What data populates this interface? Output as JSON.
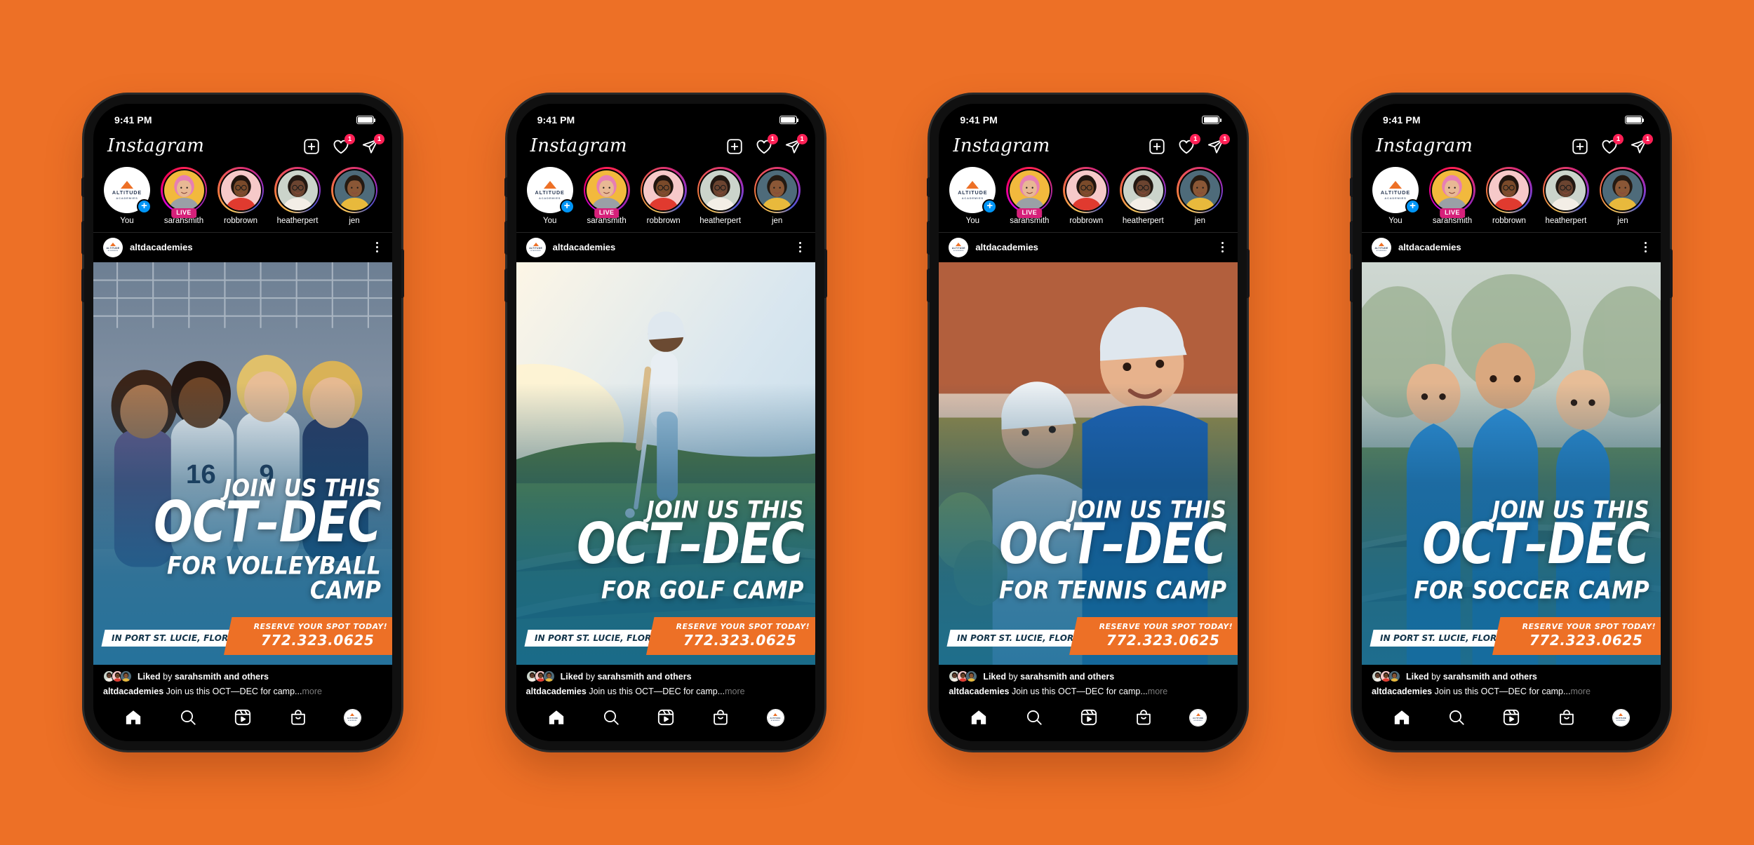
{
  "canvas": {
    "background_color": "#ED7026"
  },
  "status_bar": {
    "time": "9:41 PM",
    "battery_icon": "battery-full-icon"
  },
  "app_header": {
    "wordmark": "Instagram",
    "create_icon": "plus-square-icon",
    "activity_icon": "heart-icon",
    "activity_badge": "1",
    "messages_icon": "paper-plane-icon",
    "messages_badge": "1"
  },
  "stories": [
    {
      "name": "You",
      "ring": "none",
      "badge": "add-plus",
      "avatar": "altitude-academies-logo"
    },
    {
      "name": "sarahsmith",
      "ring": "live",
      "badge": "LIVE",
      "avatar": "woman-pink-hair"
    },
    {
      "name": "robbrown",
      "ring": "gradient",
      "badge": "",
      "avatar": "man-red-shirt-glasses"
    },
    {
      "name": "heatherpert",
      "ring": "gradient",
      "badge": "",
      "avatar": "woman-curly-hair-glasses"
    },
    {
      "name": "jen",
      "ring": "gradient",
      "badge": "",
      "avatar": "woman-yellow-top"
    }
  ],
  "post": {
    "username": "altdacademies",
    "avatar": "altitude-academies-logo",
    "menu_icon": "more-options-icon",
    "likes_prefix": "Liked",
    "likes_by": "by",
    "likes_user": "sarahsmith",
    "likes_suffix": "and others",
    "caption_user": "altdacademies",
    "caption_text": "Join us this OCT—DEC for camp...",
    "caption_more": "more"
  },
  "creative": {
    "line1": "JOIN US THIS",
    "line2": "OCT–DEC",
    "location_badge": "IN PORT ST. LUCIE, FLORIDA",
    "cta_kicker": "RESERVE YOUR SPOT TODAY!",
    "cta_phone": "772.323.0625",
    "accent_orange": "#ED7026",
    "tint_blue": "#12688F"
  },
  "phones": [
    {
      "sport_line": "FOR VOLLEYBALL CAMP",
      "photo": "volleyball-team-huddle",
      "sport": "volleyball"
    },
    {
      "sport_line": "FOR GOLF CAMP",
      "photo": "golfer-teeing-off-sunset",
      "sport": "golf"
    },
    {
      "sport_line": "FOR TENNIS CAMP",
      "photo": "tennis-coach-and-boy",
      "sport": "tennis"
    },
    {
      "sport_line": "FOR SOCCER CAMP",
      "photo": "youth-soccer-players",
      "sport": "soccer"
    }
  ],
  "tab_bar": [
    {
      "icon": "home-icon",
      "label": "Home"
    },
    {
      "icon": "search-icon",
      "label": "Search"
    },
    {
      "icon": "reels-icon",
      "label": "Reels"
    },
    {
      "icon": "shop-bag-icon",
      "label": "Shop"
    },
    {
      "icon": "profile-avatar",
      "label": "Profile"
    }
  ]
}
